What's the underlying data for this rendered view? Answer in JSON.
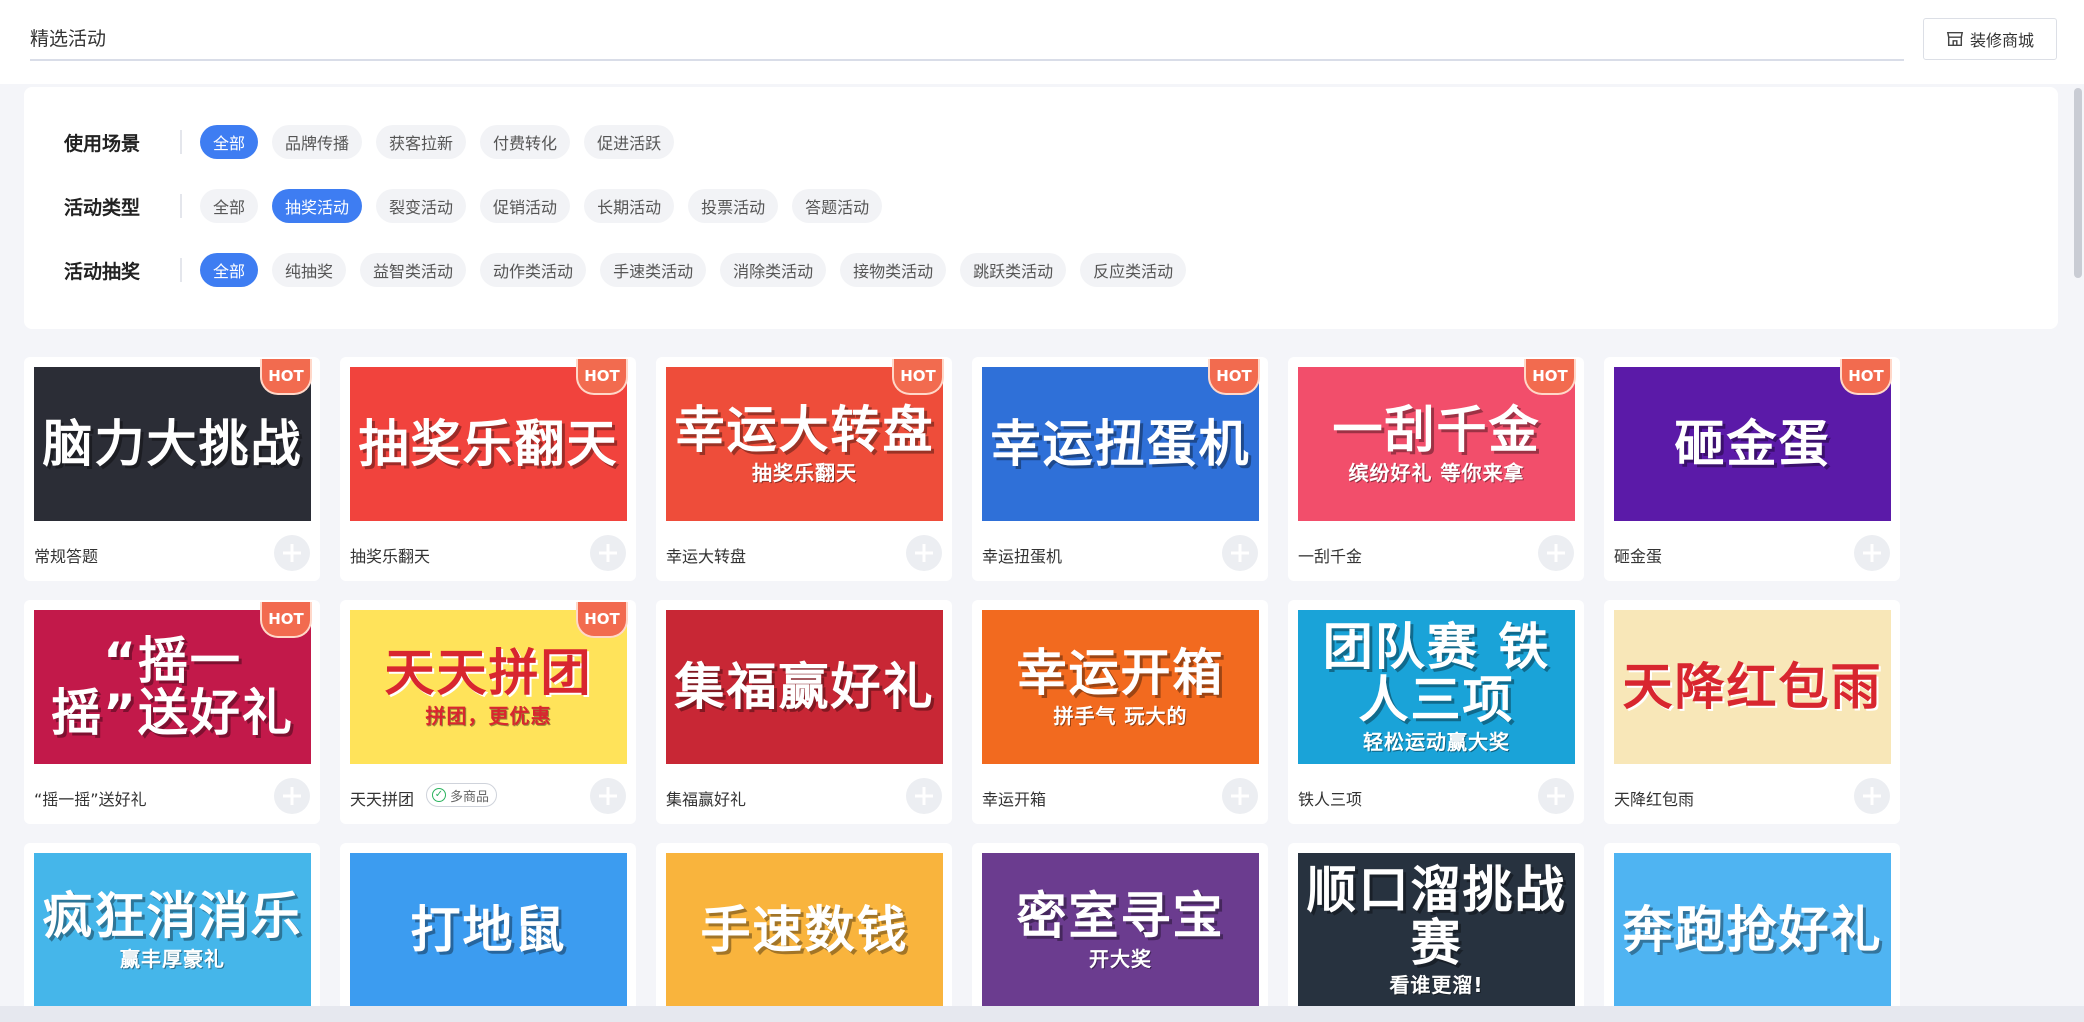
{
  "header": {
    "title": "精选活动",
    "decorate_label": "装修商城"
  },
  "filters": [
    {
      "label": "使用场景",
      "options": [
        "全部",
        "品牌传播",
        "获客拉新",
        "付费转化",
        "促进活跃"
      ],
      "active": 0
    },
    {
      "label": "活动类型",
      "options": [
        "全部",
        "抽奖活动",
        "裂变活动",
        "促销活动",
        "长期活动",
        "投票活动",
        "答题活动"
      ],
      "active": 1
    },
    {
      "label": "活动抽奖",
      "options": [
        "全部",
        "纯抽奖",
        "益智类活动",
        "动作类活动",
        "手速类活动",
        "消除类活动",
        "接物类活动",
        "跳跃类活动",
        "反应类活动"
      ],
      "active": 0
    }
  ],
  "hot_label": "HOT",
  "cards": [
    {
      "title": "常规答题",
      "art": "脑力大挑战",
      "hot": true,
      "bg": "#2b2d36"
    },
    {
      "title": "抽奖乐翻天",
      "art": "抽奖乐翻天",
      "hot": true,
      "bg": "#f1433d"
    },
    {
      "title": "幸运大转盘",
      "art": "幸运大转盘",
      "art_sub": "抽奖乐翻天",
      "hot": true,
      "bg": "#ee4d3a"
    },
    {
      "title": "幸运扭蛋机",
      "art": "幸运扭蛋机",
      "hot": true,
      "bg": "#2f70d8"
    },
    {
      "title": "一刮千金",
      "art": "一刮千金",
      "art_sub": "缤纷好礼 等你来拿",
      "hot": true,
      "bg": "#f24e6b"
    },
    {
      "title": "砸金蛋",
      "art": "砸金蛋",
      "hot": true,
      "bg": "#5b1aa8"
    },
    {
      "title": "“摇一摇”送好礼",
      "art": "“摇一摇”送好礼",
      "hot": true,
      "bg": "#c2194a"
    },
    {
      "title": "天天拼团",
      "art": "天天拼团",
      "art_sub": "拼团，更优惠",
      "hot": true,
      "bg": "#ffe35a",
      "tag": "多商品"
    },
    {
      "title": "集福赢好礼",
      "art": "集福赢好礼",
      "hot": false,
      "bg": "#c82735"
    },
    {
      "title": "幸运开箱",
      "art": "幸运开箱",
      "art_sub": "拼手气 玩大的",
      "hot": false,
      "bg": "#f26a1f"
    },
    {
      "title": "铁人三项",
      "art": "团队赛 铁人三项",
      "art_sub": "轻松运动赢大奖",
      "hot": false,
      "bg": "#1aa3d8"
    },
    {
      "title": "天降红包雨",
      "art": "天降红包雨",
      "hot": false,
      "bg": "#f8e7b8"
    },
    {
      "title": "",
      "art": "疯狂消消乐",
      "art_sub": "赢丰厚豪礼",
      "hot": false,
      "bg": "#45b6ea"
    },
    {
      "title": "",
      "art": "打地鼠",
      "hot": false,
      "bg": "#3c9cf0"
    },
    {
      "title": "",
      "art": "手速数钱",
      "hot": false,
      "bg": "#f9b43d"
    },
    {
      "title": "",
      "art": "密室寻宝",
      "art_sub": "开大奖",
      "hot": false,
      "bg": "#6b3c8f"
    },
    {
      "title": "",
      "art": "顺口溜挑战赛",
      "art_sub": "看谁更溜!",
      "hot": false,
      "bg": "#27323f"
    },
    {
      "title": "",
      "art": "奔跑抢好礼",
      "hot": false,
      "bg": "#4fb4f2"
    }
  ],
  "colors": {
    "primary": "#3e7df2",
    "hot": "#f26b4f"
  }
}
